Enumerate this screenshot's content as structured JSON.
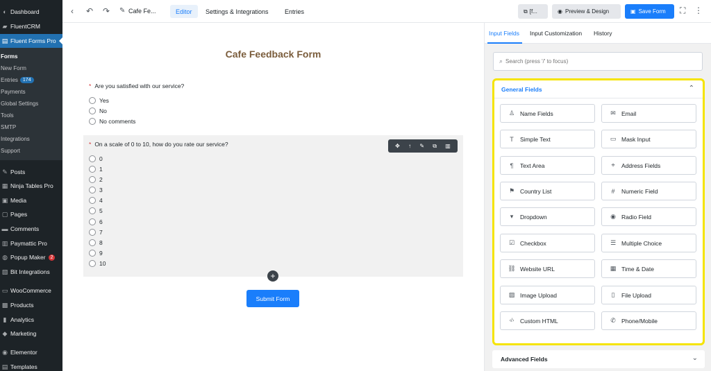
{
  "sidebar": {
    "items": [
      {
        "label": "Dashboard",
        "icon": "dashboard-icon",
        "glyph": "◐"
      },
      {
        "label": "FluentCRM",
        "icon": "crm-icon",
        "glyph": "▰"
      },
      {
        "label": "Fluent Forms Pro",
        "icon": "forms-icon",
        "glyph": "▤"
      }
    ],
    "submenu": [
      {
        "label": "Forms"
      },
      {
        "label": "New Form"
      },
      {
        "label": "Entries",
        "badge": "174"
      },
      {
        "label": "Payments"
      },
      {
        "label": "Global Settings"
      },
      {
        "label": "Tools"
      },
      {
        "label": "SMTP"
      },
      {
        "label": "Integrations"
      },
      {
        "label": "Support"
      }
    ],
    "items2": [
      {
        "label": "Posts",
        "icon": "pin-icon",
        "glyph": "✎"
      },
      {
        "label": "Ninja Tables Pro",
        "icon": "table-icon",
        "glyph": "▦"
      },
      {
        "label": "Media",
        "icon": "media-icon",
        "glyph": "▣"
      },
      {
        "label": "Pages",
        "icon": "pages-icon",
        "glyph": "▢"
      },
      {
        "label": "Comments",
        "icon": "comments-icon",
        "glyph": "▬"
      },
      {
        "label": "Paymattic Pro",
        "icon": "paymattic-icon",
        "glyph": "▥"
      },
      {
        "label": "Popup Maker",
        "icon": "popup-icon",
        "glyph": "◍",
        "badge": "2"
      },
      {
        "label": "Bit Integrations",
        "icon": "bit-icon",
        "glyph": "▧"
      },
      {
        "label": "WooCommerce",
        "icon": "woo-icon",
        "glyph": "▭"
      },
      {
        "label": "Products",
        "icon": "products-icon",
        "glyph": "▩"
      },
      {
        "label": "Analytics",
        "icon": "analytics-icon",
        "glyph": "▮"
      },
      {
        "label": "Marketing",
        "icon": "marketing-icon",
        "glyph": "◆"
      },
      {
        "label": "Elementor",
        "icon": "elementor-icon",
        "glyph": "◉"
      },
      {
        "label": "Templates",
        "icon": "templates-icon",
        "glyph": "▤"
      }
    ]
  },
  "topbar": {
    "form_name": "Cafe Fe...",
    "tabs": [
      "Editor",
      "Settings & Integrations",
      "Entries"
    ],
    "shortcode_label": "[f...",
    "preview_label": "Preview & Design",
    "save_label": "Save Form"
  },
  "form": {
    "title": "Cafe Feedback Form",
    "q1": {
      "label": "Are you satisfied with our service?",
      "options": [
        "Yes",
        "No",
        "No comments"
      ]
    },
    "q2": {
      "label": "On a scale of 0 to 10, how do you rate our service?",
      "options": [
        "0",
        "1",
        "2",
        "3",
        "4",
        "5",
        "6",
        "7",
        "8",
        "9",
        "10"
      ]
    },
    "submit_label": "Submit Form"
  },
  "panel": {
    "tabs": [
      "Input Fields",
      "Input Customization",
      "History"
    ],
    "search_placeholder": "Search (press '/' to focus)",
    "general_title": "General Fields",
    "fields": [
      {
        "label": "Name Fields",
        "icon": "user-icon",
        "glyph": "♙"
      },
      {
        "label": "Email",
        "icon": "email-icon",
        "glyph": "✉"
      },
      {
        "label": "Simple Text",
        "icon": "text-icon",
        "glyph": "T"
      },
      {
        "label": "Mask Input",
        "icon": "mask-icon",
        "glyph": "▭"
      },
      {
        "label": "Text Area",
        "icon": "textarea-icon",
        "glyph": "¶"
      },
      {
        "label": "Address Fields",
        "icon": "location-icon",
        "glyph": "⌖"
      },
      {
        "label": "Country List",
        "icon": "flag-icon",
        "glyph": "⚑"
      },
      {
        "label": "Numeric Field",
        "icon": "hash-icon",
        "glyph": "#"
      },
      {
        "label": "Dropdown",
        "icon": "dropdown-icon",
        "glyph": "▾"
      },
      {
        "label": "Radio Field",
        "icon": "radio-icon",
        "glyph": "◉"
      },
      {
        "label": "Checkbox",
        "icon": "checkbox-icon",
        "glyph": "☑"
      },
      {
        "label": "Multiple Choice",
        "icon": "list-icon",
        "glyph": "☰"
      },
      {
        "label": "Website URL",
        "icon": "link-icon",
        "glyph": "⛓"
      },
      {
        "label": "Time & Date",
        "icon": "calendar-icon",
        "glyph": "▦"
      },
      {
        "label": "Image Upload",
        "icon": "image-icon",
        "glyph": "▨"
      },
      {
        "label": "File Upload",
        "icon": "file-icon",
        "glyph": "▯"
      },
      {
        "label": "Custom HTML",
        "icon": "code-icon",
        "glyph": "‹/›"
      },
      {
        "label": "Phone/Mobile",
        "icon": "phone-icon",
        "glyph": "✆"
      }
    ],
    "advanced_title": "Advanced Fields"
  },
  "colors": {
    "accent": "#1a7efb",
    "highlight": "#f5e400",
    "title_brown": "#7a5c3b",
    "sidebar_bg": "#1d2327"
  }
}
